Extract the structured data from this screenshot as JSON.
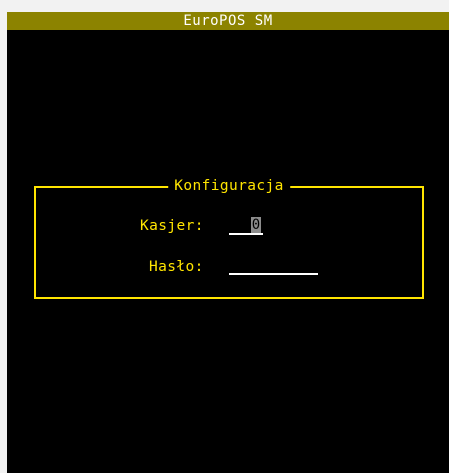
{
  "window": {
    "title": "EuroPOS SM"
  },
  "login_panel": {
    "title": "Konfiguracja",
    "cashier_label": "Kasjer:",
    "cashier_value": "0",
    "password_label": "Hasło:",
    "password_value": ""
  },
  "colors": {
    "title_bar": "#8c8300",
    "accent": "#ffe500",
    "background": "#000000",
    "cursor": "#8c8c8c"
  }
}
